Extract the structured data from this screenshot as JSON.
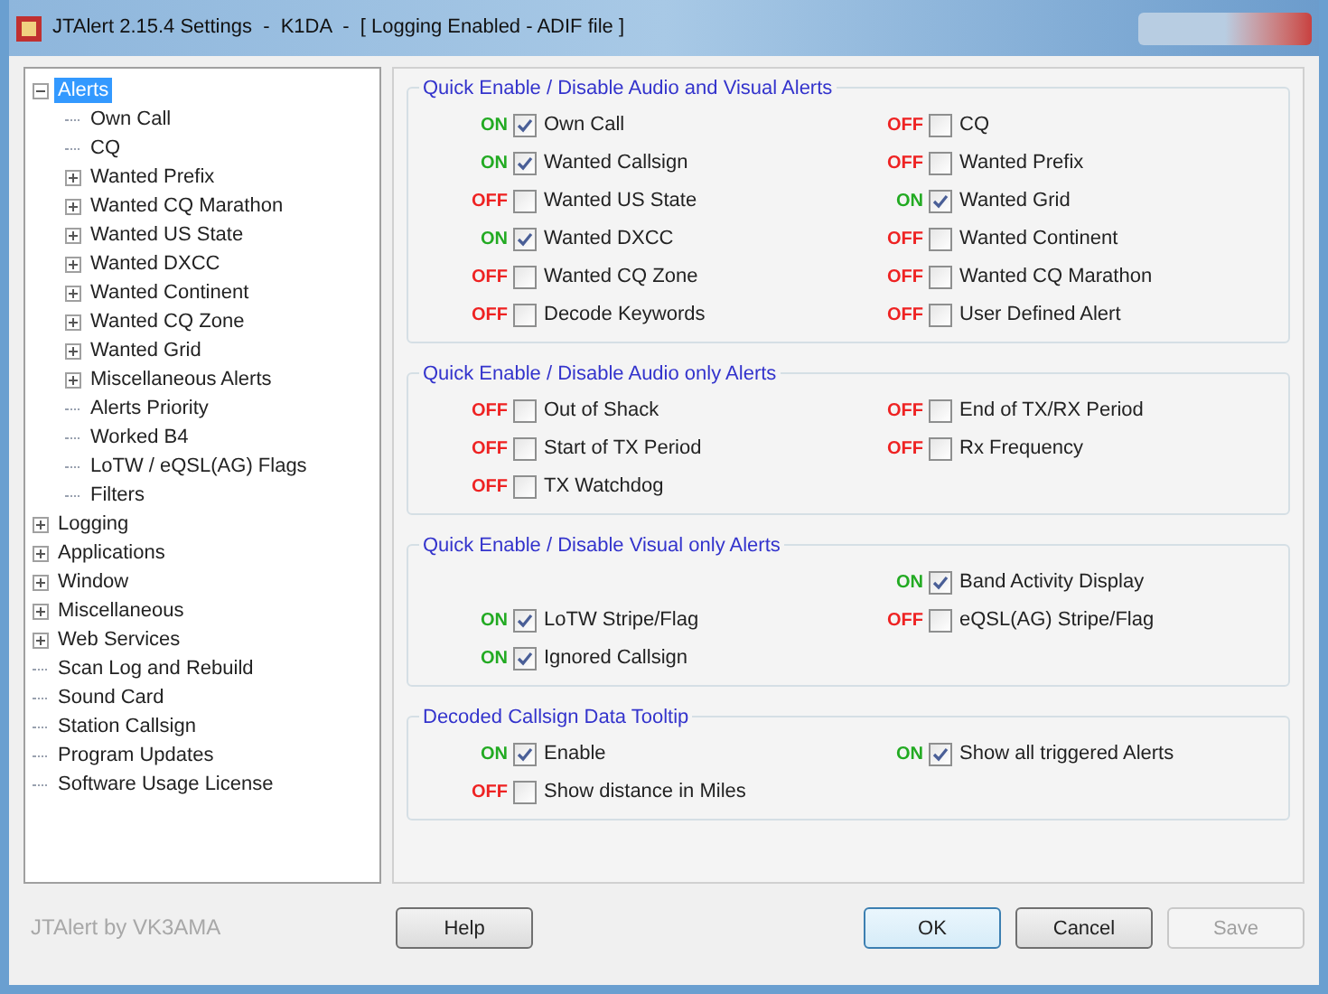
{
  "window": {
    "title": "JTAlert 2.15.4 Settings  -  K1DA  -  [ Logging Enabled - ADIF file ]"
  },
  "tree": [
    {
      "label": "Alerts",
      "selected": true,
      "expanded": true,
      "children": [
        {
          "label": "Own Call",
          "selected": false
        },
        {
          "label": "CQ",
          "selected": false
        },
        {
          "label": "Wanted Prefix",
          "selected": false,
          "expanded": false
        },
        {
          "label": "Wanted CQ Marathon",
          "selected": false,
          "expanded": false
        },
        {
          "label": "Wanted US State",
          "selected": false,
          "expanded": false
        },
        {
          "label": "Wanted DXCC",
          "selected": false,
          "expanded": false
        },
        {
          "label": "Wanted Continent",
          "selected": false,
          "expanded": false
        },
        {
          "label": "Wanted CQ Zone",
          "selected": false,
          "expanded": false
        },
        {
          "label": "Wanted Grid",
          "selected": false,
          "expanded": false
        },
        {
          "label": "Miscellaneous Alerts",
          "selected": false,
          "expanded": false
        },
        {
          "label": "Alerts Priority",
          "selected": false
        },
        {
          "label": "Worked B4",
          "selected": false
        },
        {
          "label": "LoTW / eQSL(AG) Flags",
          "selected": false
        },
        {
          "label": "Filters",
          "selected": false
        }
      ]
    },
    {
      "label": "Logging",
      "selected": false,
      "expanded": false
    },
    {
      "label": "Applications",
      "selected": false,
      "expanded": false
    },
    {
      "label": "Window",
      "selected": false,
      "expanded": false
    },
    {
      "label": "Miscellaneous",
      "selected": false,
      "expanded": false
    },
    {
      "label": "Web Services",
      "selected": false,
      "expanded": false
    },
    {
      "label": "Scan Log and Rebuild",
      "selected": false
    },
    {
      "label": "Sound Card",
      "selected": false
    },
    {
      "label": "Station Callsign",
      "selected": false
    },
    {
      "label": "Program Updates",
      "selected": false
    },
    {
      "label": "Software Usage License",
      "selected": false
    }
  ],
  "footer": "JTAlert by VK3AMA",
  "groups": [
    {
      "title": "Quick Enable / Disable Audio and Visual Alerts",
      "rows": [
        [
          {
            "flag": "ON",
            "checked": true,
            "label": "Own Call"
          },
          {
            "flag": "OFF",
            "checked": false,
            "label": "CQ"
          }
        ],
        [
          {
            "flag": "ON",
            "checked": true,
            "label": "Wanted Callsign"
          },
          {
            "flag": "OFF",
            "checked": false,
            "label": "Wanted Prefix"
          }
        ],
        [
          {
            "flag": "OFF",
            "checked": false,
            "label": "Wanted US State"
          },
          {
            "flag": "ON",
            "checked": true,
            "label": "Wanted Grid"
          }
        ],
        [
          {
            "flag": "ON",
            "checked": true,
            "label": "Wanted DXCC"
          },
          {
            "flag": "OFF",
            "checked": false,
            "label": "Wanted Continent"
          }
        ],
        [
          {
            "flag": "OFF",
            "checked": false,
            "label": "Wanted CQ Zone"
          },
          {
            "flag": "OFF",
            "checked": false,
            "label": "Wanted CQ Marathon"
          }
        ],
        [
          {
            "flag": "OFF",
            "checked": false,
            "label": "Decode Keywords"
          },
          {
            "flag": "OFF",
            "checked": false,
            "label": "User Defined Alert"
          }
        ]
      ]
    },
    {
      "title": "Quick Enable / Disable Audio only Alerts",
      "rows": [
        [
          {
            "flag": "OFF",
            "checked": false,
            "label": "Out of Shack"
          },
          {
            "flag": "OFF",
            "checked": false,
            "label": "End of TX/RX Period"
          }
        ],
        [
          {
            "flag": "OFF",
            "checked": false,
            "label": "Start of TX Period"
          },
          {
            "flag": "OFF",
            "checked": false,
            "label": "Rx Frequency"
          }
        ],
        [
          {
            "flag": "OFF",
            "checked": false,
            "label": "TX Watchdog"
          },
          null
        ]
      ]
    },
    {
      "title": "Quick Enable / Disable Visual only Alerts",
      "rows": [
        [
          null,
          {
            "flag": "ON",
            "checked": true,
            "label": "Band Activity Display"
          }
        ],
        [
          {
            "flag": "ON",
            "checked": true,
            "label": "LoTW Stripe/Flag"
          },
          {
            "flag": "OFF",
            "checked": false,
            "label": "eQSL(AG) Stripe/Flag"
          }
        ],
        [
          {
            "flag": "ON",
            "checked": true,
            "label": "Ignored Callsign"
          },
          null
        ]
      ]
    },
    {
      "title": "Decoded Callsign Data Tooltip",
      "rows": [
        [
          {
            "flag": "ON",
            "checked": true,
            "label": "Enable"
          },
          {
            "flag": "ON",
            "checked": true,
            "label": "Show all triggered Alerts"
          }
        ],
        [
          {
            "flag": "OFF",
            "checked": false,
            "label": "Show distance in Miles"
          },
          null
        ]
      ]
    }
  ],
  "buttons": [
    {
      "label": "Help",
      "kind": "normal",
      "disabled": false
    },
    {
      "label": "OK",
      "kind": "default",
      "disabled": false
    },
    {
      "label": "Cancel",
      "kind": "normal",
      "disabled": false
    },
    {
      "label": "Save",
      "kind": "normal",
      "disabled": true
    }
  ]
}
